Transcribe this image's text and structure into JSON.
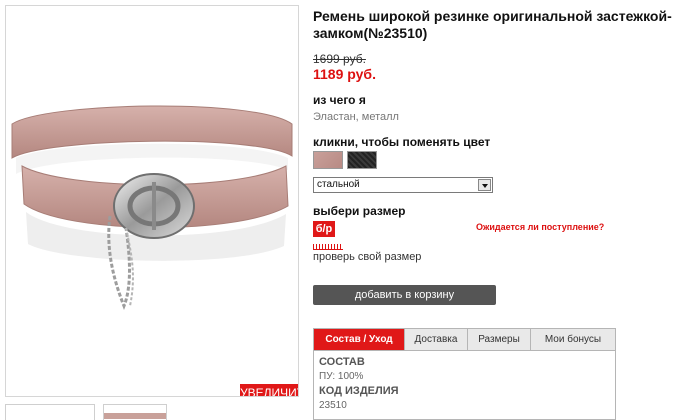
{
  "product": {
    "title": "Ремень широкой резинке оригинальной застежкой-замком(№23510)",
    "old_price": "1699 руб.",
    "new_price": "1189 руб."
  },
  "gallery": {
    "zoom_label": "УВЕЛИЧИТЬ"
  },
  "material": {
    "label": "из чего я",
    "value": "Эластан, металл"
  },
  "color": {
    "label": "кликни, чтобы поменять цвет",
    "swatches": [
      "pink-beige",
      "black"
    ],
    "selected": "стальной"
  },
  "size": {
    "label": "выбери размер",
    "badge": "б/р",
    "availability_link": "Ожидается ли поступление?",
    "guide_link": "проверь свой размер"
  },
  "cart": {
    "add_label": "добавить в корзину"
  },
  "tabs": [
    {
      "label": "Состав / Уход"
    },
    {
      "label": "Доставка"
    },
    {
      "label": "Размеры"
    },
    {
      "label": "Мои бонусы"
    }
  ],
  "details": {
    "composition_heading": "СОСТАВ",
    "composition_value": "ПУ: 100%",
    "code_heading": "КОД ИЗДЕЛИЯ",
    "code_value": "23510"
  },
  "colors": {
    "accent": "#e01818",
    "button": "#555555",
    "belt": "#c9a09a"
  }
}
